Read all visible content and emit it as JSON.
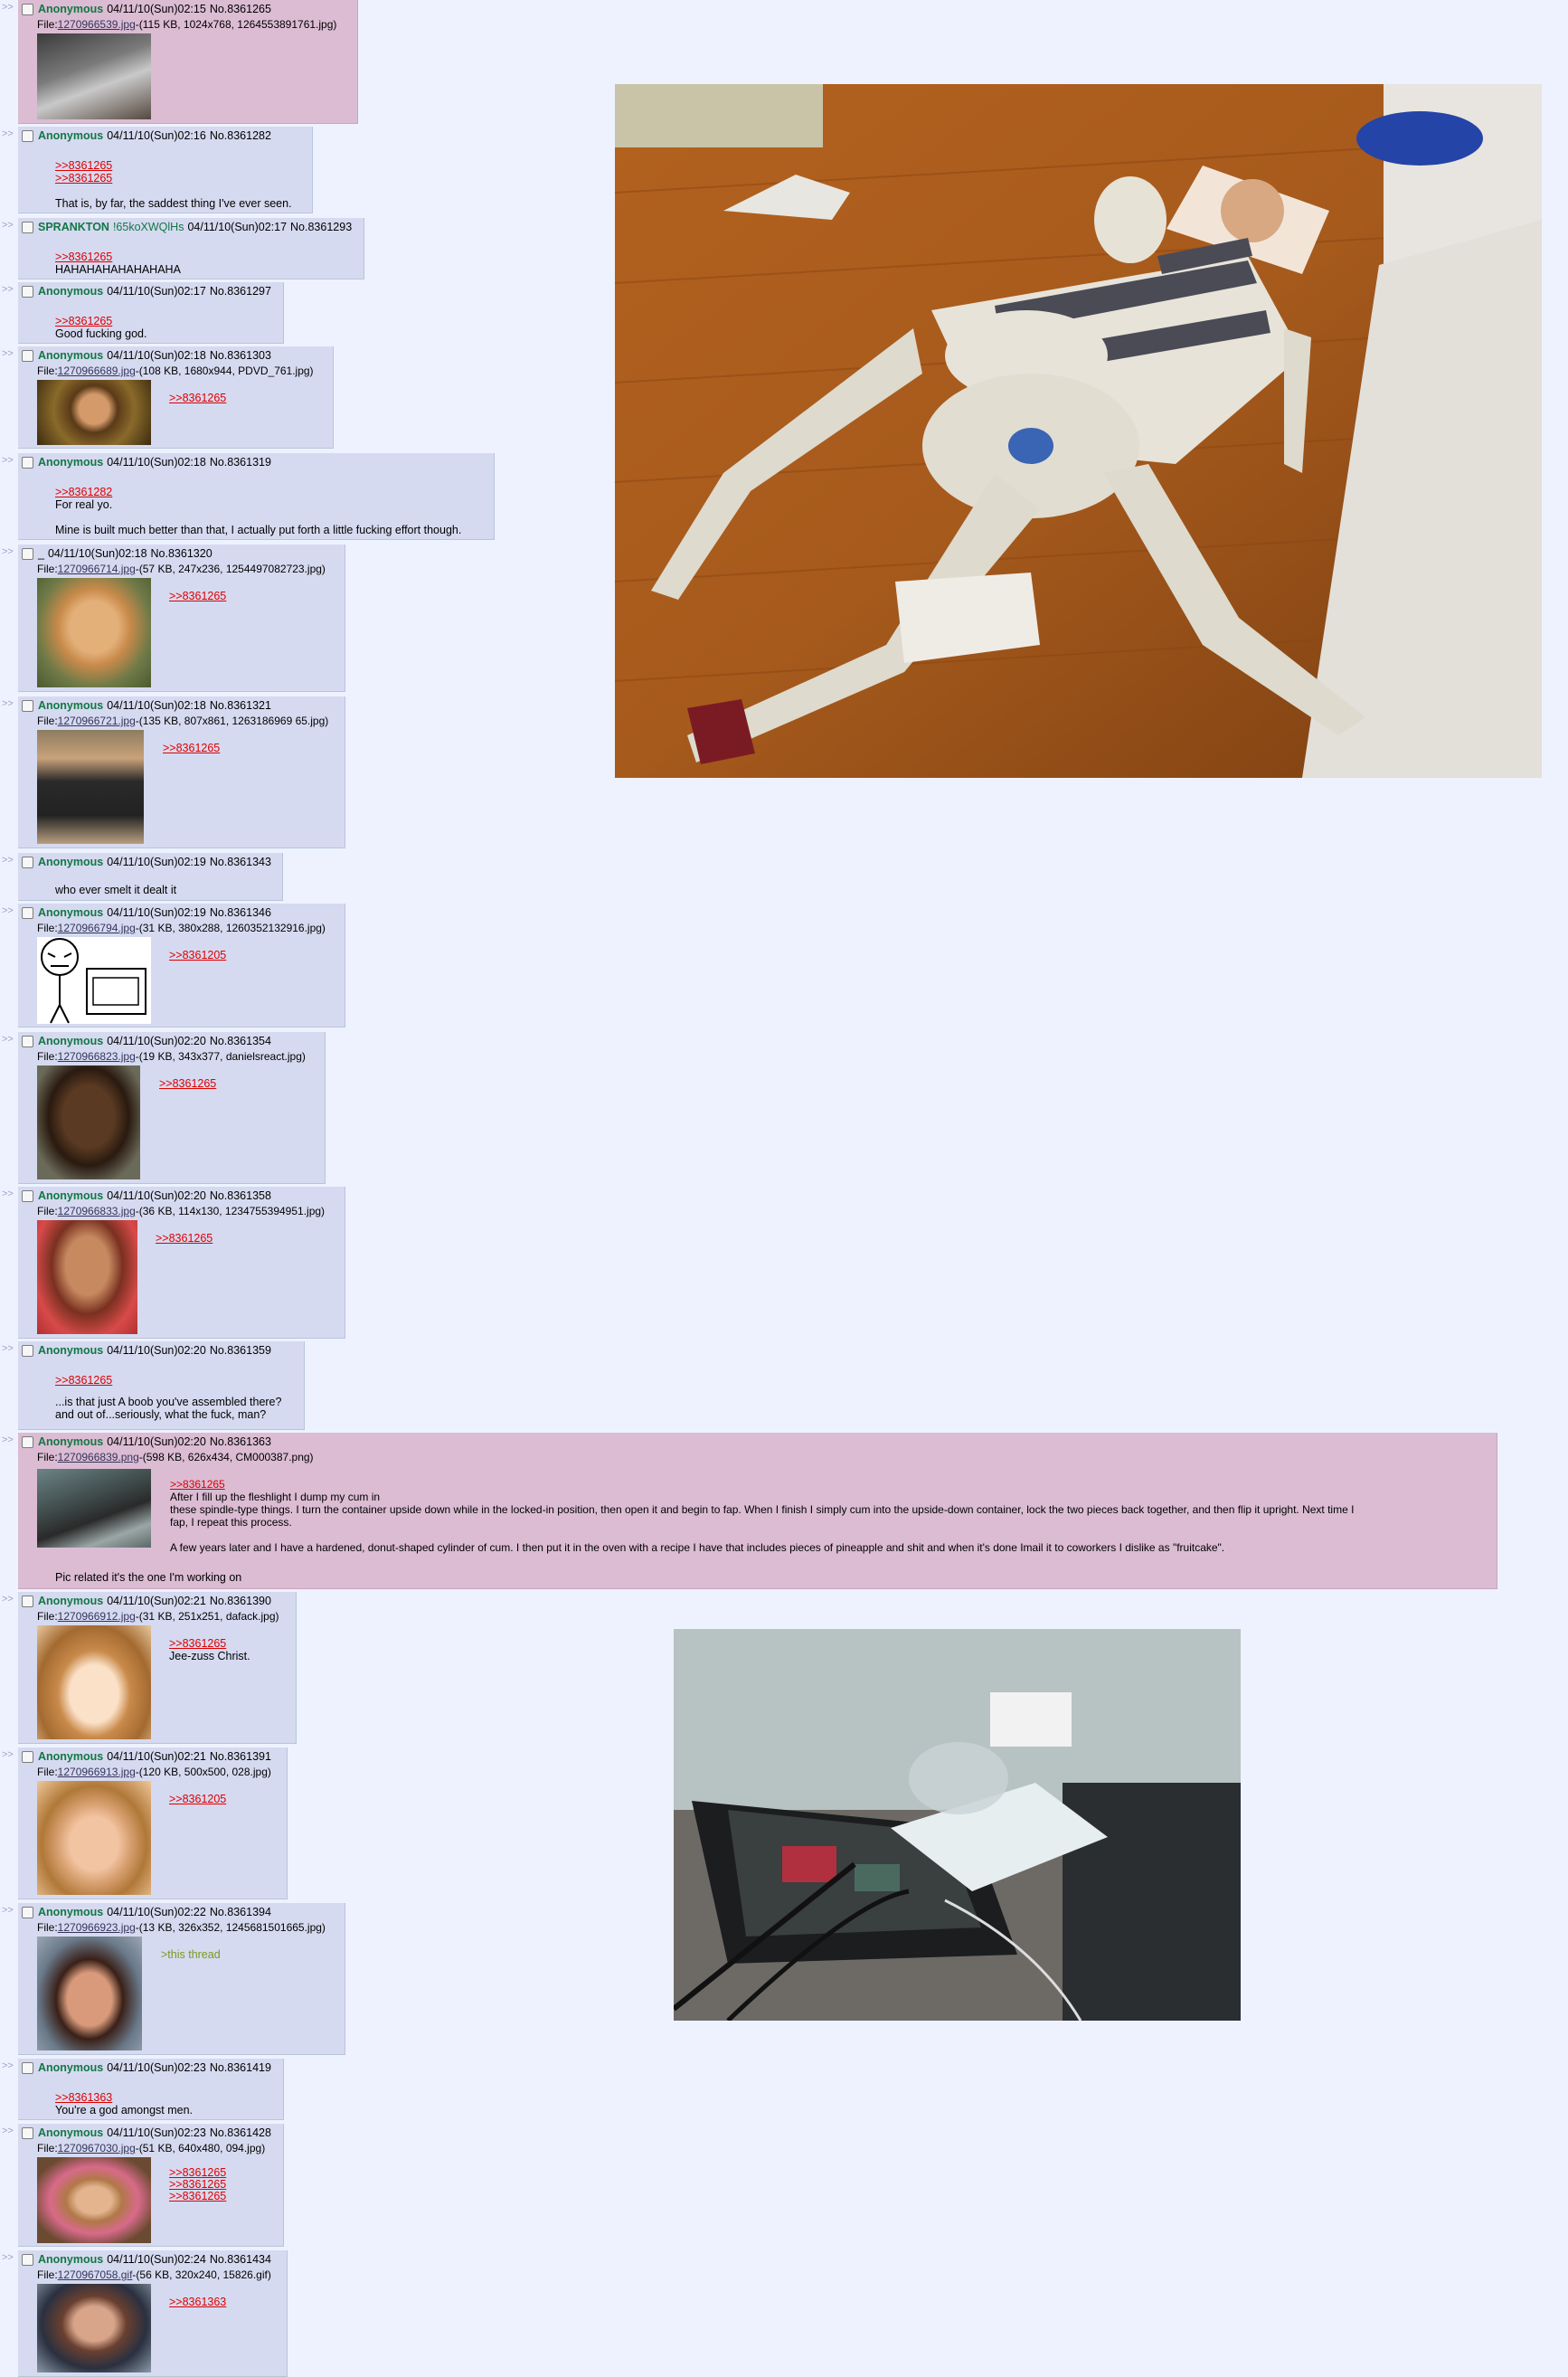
{
  "thread_posts": [
    {
      "name": "Anonymous",
      "date": "04/11/10(Sun)02:15",
      "no": "No.8361265",
      "file_label": "File:",
      "file_link": "1270966539.jpg",
      "file_info": "-(115 KB, 1024x768, 1264553891761.jpg)",
      "quotes": [],
      "lines": []
    },
    {
      "name": "Anonymous",
      "date": "04/11/10(Sun)02:16",
      "no": "No.8361282",
      "quotes": [
        ">>8361265",
        ">>8361265"
      ],
      "lines": [
        "That is, by far, the saddest thing I've ever seen."
      ]
    },
    {
      "name": "SPRANKTON",
      "trip": "!65koXWQlHs",
      "date": "04/11/10(Sun)02:17",
      "no": "No.8361293",
      "quotes": [
        ">>8361265"
      ],
      "lines": [
        "HAHAHAHAHAHAHAHA"
      ]
    },
    {
      "name": "Anonymous",
      "date": "04/11/10(Sun)02:17",
      "no": "No.8361297",
      "quotes": [
        ">>8361265"
      ],
      "lines": [
        "Good fucking god."
      ]
    },
    {
      "name": "Anonymous",
      "date": "04/11/10(Sun)02:18",
      "no": "No.8361303",
      "file_label": "File:",
      "file_link": "1270966689.jpg",
      "file_info": "-(108 KB, 1680x944, PDVD_761.jpg)",
      "quotes": [
        ">>8361265"
      ],
      "lines": []
    },
    {
      "name": "Anonymous",
      "date": "04/11/10(Sun)02:18",
      "no": "No.8361319",
      "quotes": [
        ">>8361282"
      ],
      "lines": [
        "For real yo.",
        "",
        "Mine is built much better than that, I actually put forth a little fucking effort though."
      ]
    },
    {
      "name": "_",
      "date": "04/11/10(Sun)02:18",
      "no": "No.8361320",
      "file_label": "File:",
      "file_link": "1270966714.jpg",
      "file_info": "-(57 KB, 247x236, 1254497082723.jpg)",
      "quotes": [
        ">>8361265"
      ],
      "lines": []
    },
    {
      "name": "Anonymous",
      "date": "04/11/10(Sun)02:18",
      "no": "No.8361321",
      "file_label": "File:",
      "file_link": "1270966721.jpg",
      "file_info": "-(135 KB, 807x861, 1263186969 65.jpg)",
      "quotes": [
        ">>8361265"
      ],
      "lines": []
    },
    {
      "name": "Anonymous",
      "date": "04/11/10(Sun)02:19",
      "no": "No.8361343",
      "quotes": [],
      "lines": [
        "who ever smelt it dealt it"
      ]
    },
    {
      "name": "Anonymous",
      "date": "04/11/10(Sun)02:19",
      "no": "No.8361346",
      "file_label": "File:",
      "file_link": "1270966794.jpg",
      "file_info": "-(31 KB, 380x288, 1260352132916.jpg)",
      "quotes": [
        ">>8361205"
      ],
      "lines": []
    },
    {
      "name": "Anonymous",
      "date": "04/11/10(Sun)02:20",
      "no": "No.8361354",
      "file_label": "File:",
      "file_link": "1270966823.jpg",
      "file_info": "-(19 KB, 343x377, danielsreact.jpg)",
      "quotes": [
        ">>8361265"
      ],
      "lines": []
    },
    {
      "name": "Anonymous",
      "date": "04/11/10(Sun)02:20",
      "no": "No.8361358",
      "file_label": "File:",
      "file_link": "1270966833.jpg",
      "file_info": "-(36 KB, 114x130, 1234755394951.jpg)",
      "quotes": [
        ">>8361265"
      ],
      "lines": []
    },
    {
      "name": "Anonymous",
      "date": "04/11/10(Sun)02:20",
      "no": "No.8361359",
      "quotes": [
        ">>8361265"
      ],
      "lines": [
        "",
        "...is that just A boob you've assembled there?",
        "and out of...seriously, what the fuck, man?"
      ]
    },
    {
      "name": "Anonymous",
      "date": "04/11/10(Sun)02:20",
      "no": "No.8361363",
      "file_label": "File:",
      "file_link": "1270966839.png",
      "file_info": "-(598 KB, 626x434, CM000387.png)",
      "quotes": [
        ">>8361265"
      ],
      "lines": [
        "After I fill up the fleshlight I dump my cum in",
        "these spindle-type things. I turn the container upside down while in the locked-in position, then open it and begin to fap. When I finish I simply cum into the upside-down container, lock the two pieces back together, and then flip it upright. Next time I",
        "fap, I repeat this process.",
        "",
        "A few years later and I have a hardened, donut-shaped cylinder of cum. I then put it in the oven with a recipe I have that includes pieces of pineapple and shit and when it's done Imail it to coworkers I dislike as \"fruitcake\"."
      ],
      "footer": "Pic related it's the one I'm working on"
    },
    {
      "name": "Anonymous",
      "date": "04/11/10(Sun)02:21",
      "no": "No.8361390",
      "file_label": "File:",
      "file_link": "1270966912.jpg",
      "file_info": "-(31 KB, 251x251, dafack.jpg)",
      "quotes": [
        ">>8361265"
      ],
      "lines": [
        "Jee-zuss Christ."
      ]
    },
    {
      "name": "Anonymous",
      "date": "04/11/10(Sun)02:21",
      "no": "No.8361391",
      "file_label": "File:",
      "file_link": "1270966913.jpg",
      "file_info": "-(120 KB, 500x500, 028.jpg)",
      "quotes": [
        ">>8361205"
      ],
      "lines": []
    },
    {
      "name": "Anonymous",
      "date": "04/11/10(Sun)02:22",
      "no": "No.8361394",
      "file_label": "File:",
      "file_link": "1270966923.jpg",
      "file_info": "-(13 KB, 326x352, 1245681501665.jpg)",
      "quotes": [],
      "greentext": ">this thread",
      "lines": []
    },
    {
      "name": "Anonymous",
      "date": "04/11/10(Sun)02:23",
      "no": "No.8361419",
      "quotes": [
        ">>8361363"
      ],
      "lines": [
        "You're a god amongst men."
      ]
    },
    {
      "name": "Anonymous",
      "date": "04/11/10(Sun)02:23",
      "no": "No.8361428",
      "file_label": "File:",
      "file_link": "1270967030.jpg",
      "file_info": "-(51 KB, 640x480, 094.jpg)",
      "quotes": [
        ">>8361265",
        ">>8361265",
        ">>8361265"
      ],
      "lines": []
    },
    {
      "name": "Anonymous",
      "date": "04/11/10(Sun)02:24",
      "no": "No.8361434",
      "file_label": "File:",
      "file_link": "1270967058.gif",
      "file_info": "-(56 KB, 320x240, 15826.gif)",
      "quotes": [
        ">>8361363"
      ],
      "lines": []
    }
  ],
  "reply_arrow": ">>",
  "colors": {
    "background": "#eef2ff",
    "post_bg": "#d6daf0",
    "highlight_bg": "#dbbcd3",
    "name": "#117743",
    "quote_link": "#dd0000",
    "greentext": "#789922"
  },
  "icons": [
    "checkbox-icon"
  ]
}
